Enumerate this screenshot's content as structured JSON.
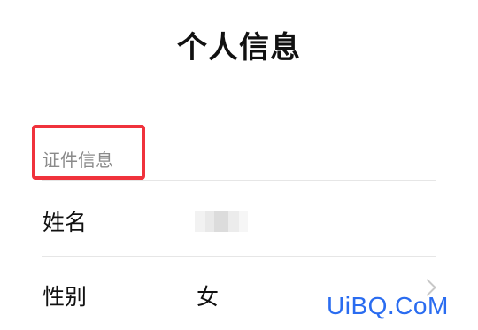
{
  "page": {
    "title": "个人信息"
  },
  "section": {
    "header": "证件信息"
  },
  "rows": [
    {
      "label": "姓名",
      "value": ""
    },
    {
      "label": "性别",
      "value": "女"
    }
  ],
  "colors": {
    "highlight": "#f0323c",
    "watermark": "#2a6cf0",
    "muted_text": "#8a8a8a"
  },
  "icons": {
    "row_chevron": "chevron-right-icon"
  },
  "watermark": {
    "text": "UiBQ.CoM"
  }
}
